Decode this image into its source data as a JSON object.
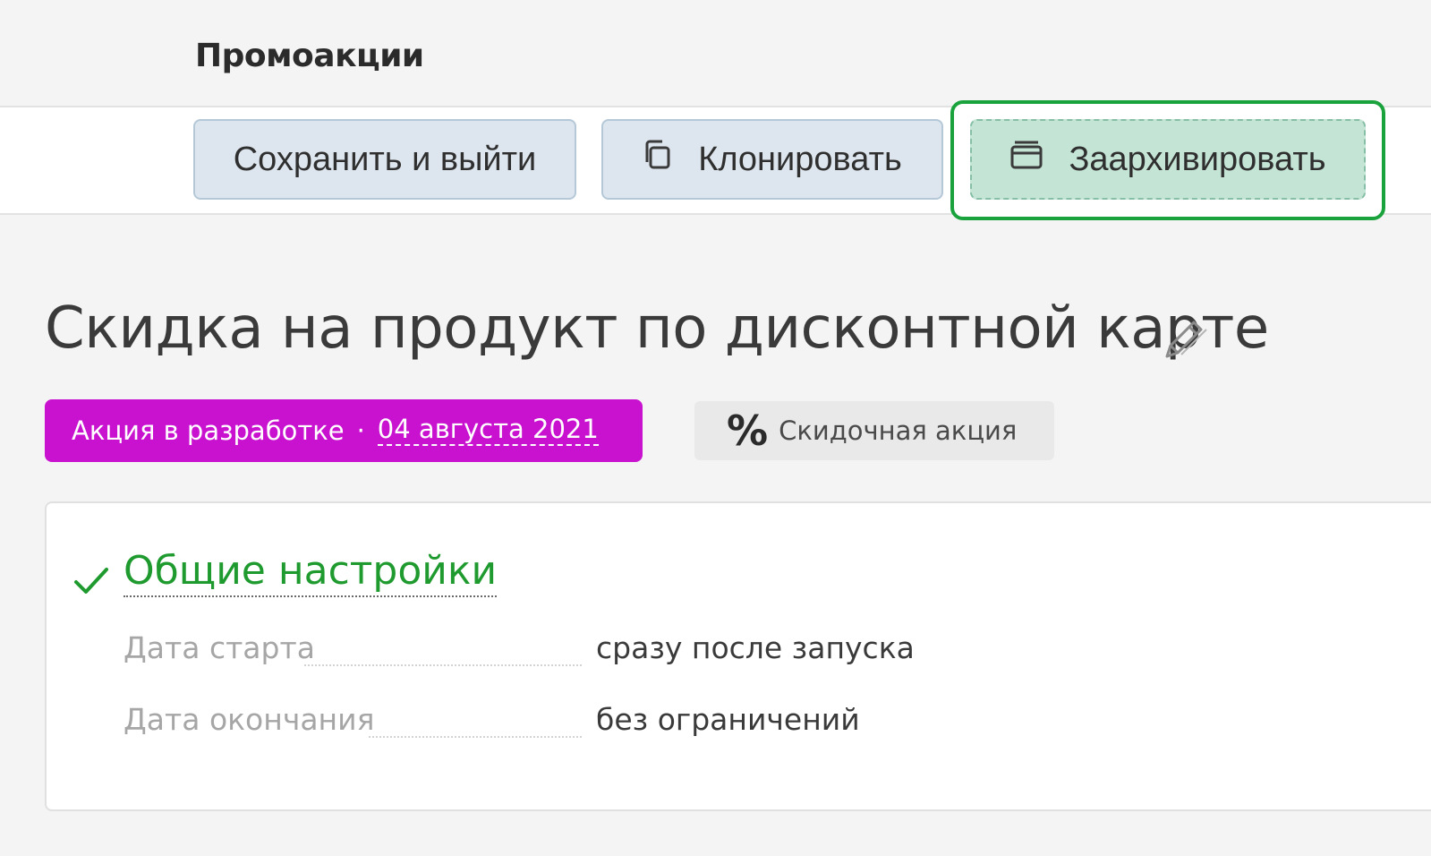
{
  "header": {
    "section_title": "Промоакции"
  },
  "toolbar": {
    "save_label": "Сохранить и выйти",
    "clone_label": "Клонировать",
    "archive_label": "Заархивировать"
  },
  "promo": {
    "title": "Скидка на продукт по дисконтной карте",
    "status": "Акция в разработке",
    "separator": "·",
    "date": "04 августа 2021",
    "status_color": "#c912cf",
    "type_symbol": "%",
    "type_label": "Скидочная акция"
  },
  "general_settings": {
    "heading": "Общие настройки",
    "accent_color": "#1e9a2e",
    "fields": [
      {
        "label": "Дата старта",
        "value": "сразу после запуска"
      },
      {
        "label": "Дата окончания",
        "value": "без ограничений"
      }
    ]
  },
  "icons": {
    "clone": "copy-icon",
    "archive": "archive-icon",
    "edit": "pencil-icon",
    "check": "check-icon"
  }
}
